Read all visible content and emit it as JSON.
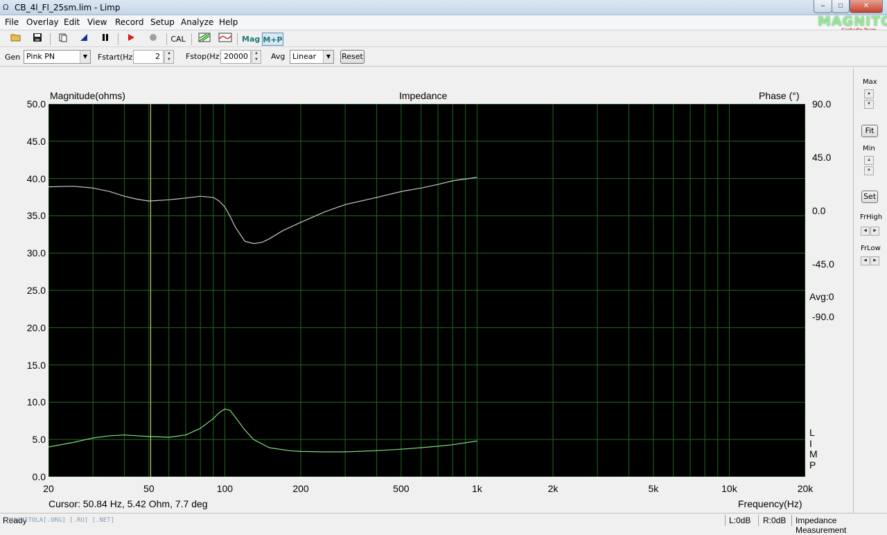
{
  "window": {
    "title": "CB_4l_Fl_25sm.lim - Limp",
    "app_icon": "Ω",
    "min_label": "–",
    "max_label": "□",
    "close_label": "✕"
  },
  "logo": {
    "text": "MAGNITOLA",
    "sub": "CarAudio Team"
  },
  "menu": [
    "File",
    "Overlay",
    "Edit",
    "View",
    "Record",
    "Setup",
    "Analyze",
    "Help"
  ],
  "toolbar": {
    "icons": [
      "open-folder-icon",
      "save-icon",
      "copy-icon",
      "marker-icon",
      "pause-icon",
      "play-icon",
      "stop-icon"
    ],
    "cal_label": "CAL",
    "mag_label": "Mag",
    "mp_label": "M+P"
  },
  "gen": {
    "gen_label": "Gen",
    "gen_value": "Pink PN",
    "fstart_label": "Fstart(Hz)",
    "fstart_value": "2",
    "fstop_label": "Fstop(Hz)",
    "fstop_value": "20000",
    "avg_label": "Avg",
    "avg_value": "Linear",
    "reset_label": "Reset"
  },
  "graph": {
    "title": "Impedance",
    "left_label": "Magnitude(ohms)",
    "right_label": "Phase (°)",
    "x_label": "Frequency(Hz)",
    "cursor": "Cursor: 50.84 Hz, 5.42 Ohm, 7.7 deg",
    "avg_text": "Avg:0",
    "limp": [
      "L",
      "I",
      "M",
      "P"
    ],
    "mag_ticks": [
      "50.0",
      "45.0",
      "40.0",
      "35.0",
      "30.0",
      "25.0",
      "20.0",
      "15.0",
      "10.0",
      "5.0",
      "0.0"
    ],
    "phase_ticks": [
      "90.0",
      "45.0",
      "0.0",
      "-45.0",
      "-90.0"
    ],
    "freq_ticks": [
      "20",
      "50",
      "100",
      "200",
      "500",
      "1k",
      "2k",
      "5k",
      "10k",
      "20k"
    ]
  },
  "chart_data": {
    "type": "line",
    "title": "Impedance",
    "xlabel": "Frequency(Hz)",
    "ylabel": "Magnitude(ohms)",
    "y2label": "Phase (°)",
    "xscale": "log",
    "xlim": [
      20,
      20000
    ],
    "ylim": [
      0,
      50
    ],
    "y2lim": [
      -225,
      90
    ],
    "cursor_hz": 50.84,
    "grid": true,
    "series": [
      {
        "axis": "magnitude",
        "color": "#7be37b",
        "x": [
          20,
          25,
          30,
          35,
          40,
          45,
          50,
          55,
          60,
          70,
          80,
          90,
          95,
          100,
          105,
          110,
          120,
          130,
          150,
          180,
          200,
          250,
          300,
          400,
          500,
          600,
          700,
          800,
          1000
        ],
        "y": [
          4.0,
          4.6,
          5.2,
          5.5,
          5.6,
          5.5,
          5.4,
          5.35,
          5.3,
          5.6,
          6.5,
          7.8,
          8.6,
          9.1,
          8.9,
          8.0,
          6.3,
          5.0,
          3.9,
          3.5,
          3.4,
          3.35,
          3.35,
          3.5,
          3.7,
          3.9,
          4.1,
          4.3,
          4.8
        ]
      },
      {
        "axis": "phase",
        "color": "#c8c8c8",
        "x": [
          20,
          25,
          30,
          35,
          40,
          45,
          50,
          60,
          70,
          80,
          90,
          95,
          100,
          105,
          110,
          120,
          130,
          140,
          150,
          170,
          200,
          250,
          300,
          400,
          500,
          600,
          700,
          800,
          1000
        ],
        "y": [
          20,
          20.5,
          19,
          16,
          12,
          9.5,
          8,
          9,
          10.5,
          12,
          11,
          8,
          3,
          -5,
          -14,
          -26,
          -28,
          -27,
          -24,
          -17,
          -10,
          -1,
          5,
          11,
          16,
          19,
          22,
          25,
          28
        ]
      }
    ]
  },
  "right_panel": {
    "max_label": "Max",
    "fit_label": "Fit",
    "min_label": "Min",
    "set_label": "Set",
    "frhigh_label": "FrHigh",
    "frlow_label": "FrLow"
  },
  "status": {
    "ready": "Ready",
    "watermark": "[MAGNITOLA[.ORG] [.RU] [.NET]",
    "l": "L:0dB",
    "r": "R:0dB",
    "mode": "Impedance Measurement"
  }
}
